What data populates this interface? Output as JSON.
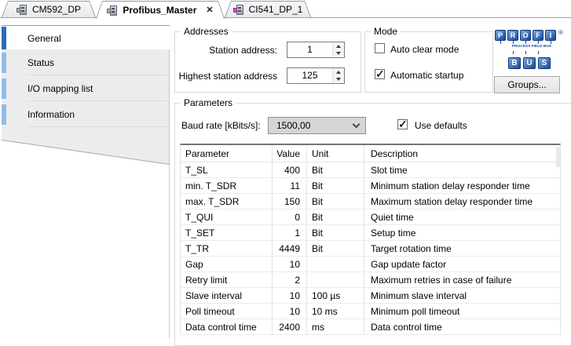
{
  "doc_tabs": [
    {
      "label": "CM592_DP",
      "active": false,
      "icon": "dp-module-icon",
      "close_glyph": ""
    },
    {
      "label": "Profibus_Master",
      "active": true,
      "icon": "dp-module-icon",
      "close_glyph": "✕"
    },
    {
      "label": "CI541_DP_1",
      "active": false,
      "icon": "ci-module-icon",
      "close_glyph": ""
    }
  ],
  "side_tabs": [
    {
      "label": "General",
      "active": true
    },
    {
      "label": "Status",
      "active": false
    },
    {
      "label": "I/O mapping list",
      "active": false
    },
    {
      "label": "Information",
      "active": false
    }
  ],
  "addresses": {
    "legend": "Addresses",
    "station_label": "Station address:",
    "station_value": "1",
    "highest_label": "Highest station address",
    "highest_value": "125"
  },
  "mode": {
    "legend": "Mode",
    "options": [
      {
        "label": "Auto clear mode",
        "checked": false
      },
      {
        "label": "Automatic startup",
        "checked": true
      }
    ]
  },
  "profibus_logo": {
    "top_letters": [
      "P",
      "R",
      "O",
      "F",
      "I"
    ],
    "registered": "®",
    "subtitle": "PROCESS FIELD BUS",
    "bottom_letters": [
      "B",
      "U",
      "S"
    ],
    "brand_blue": "#16479b"
  },
  "groups_button_label": "Groups...",
  "parameters": {
    "legend": "Parameters",
    "baud_label": "Baud rate [kBits/s]:",
    "baud_value": "1500,00",
    "use_defaults_label": "Use defaults",
    "use_defaults_checked": true
  },
  "table": {
    "headers": [
      "Parameter",
      "Value",
      "Unit",
      "Description"
    ],
    "rows": [
      [
        "T_SL",
        "400",
        "Bit",
        "Slot time"
      ],
      [
        "min. T_SDR",
        "11",
        "Bit",
        "Minimum station delay responder time"
      ],
      [
        "max. T_SDR",
        "150",
        "Bit",
        "Maximum station delay responder time"
      ],
      [
        "T_QUI",
        "0",
        "Bit",
        "Quiet time"
      ],
      [
        "T_SET",
        "1",
        "Bit",
        "Setup time"
      ],
      [
        "T_TR",
        "4449",
        "Bit",
        "Target rotation time"
      ],
      [
        "Gap",
        "10",
        "",
        "Gap update factor"
      ],
      [
        "Retry limit",
        "2",
        "",
        "Maximum retries in case of failure"
      ],
      [
        "Slave interval",
        "10",
        "100 µs",
        "Minimum slave interval"
      ],
      [
        "Poll timeout",
        "10",
        "10 ms",
        "Minimum poll timeout"
      ],
      [
        "Data control time",
        "2400",
        "ms",
        "Data control time"
      ]
    ]
  }
}
